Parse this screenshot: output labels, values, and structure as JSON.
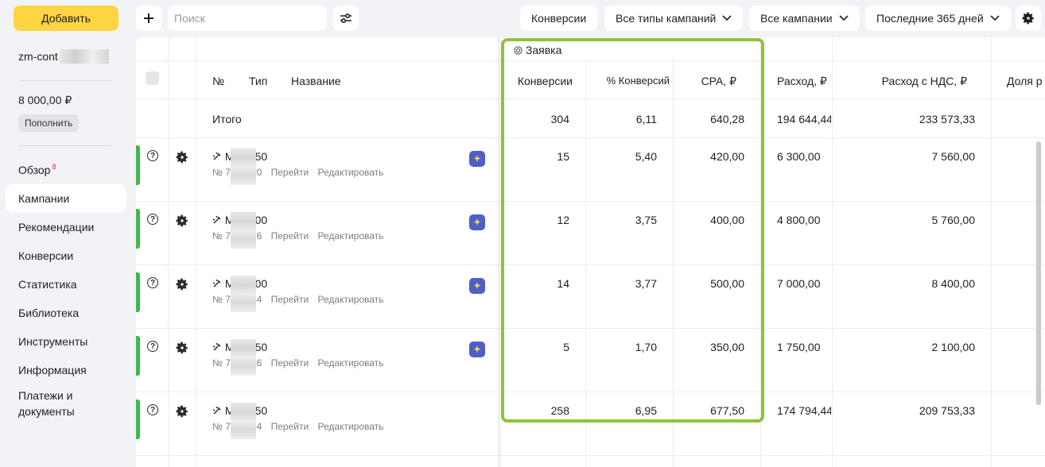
{
  "sidebar": {
    "add_button": "Добавить",
    "account": "zm-cont",
    "balance": "8 000,00 ₽",
    "topup_button": "Пополнить",
    "nav": [
      {
        "label": "Обзор",
        "badge": "8"
      },
      {
        "label": "Кампании"
      },
      {
        "label": "Рекомендации"
      },
      {
        "label": "Конверсии"
      },
      {
        "label": "Статистика"
      },
      {
        "label": "Библиотека"
      },
      {
        "label": "Инструменты"
      },
      {
        "label": "Информация"
      },
      {
        "label": "Платежи и документы"
      }
    ]
  },
  "toolbar": {
    "search_placeholder": "Поиск",
    "conversions_button": "Конверсии",
    "campaign_types": "Все типы кампаний",
    "campaigns": "Все кампании",
    "period": "Последние 365 дней"
  },
  "table": {
    "group_header": "Заявка",
    "headers": {
      "num": "№",
      "type": "Тип",
      "name": "Название",
      "conversions": "Конверсии",
      "conv_pct": "% Конверсий",
      "cpa": "CPA, ₽",
      "spend": "Расход, ₽",
      "spend_vat": "Расход с НДС, ₽",
      "share": "Доля р"
    },
    "total": {
      "label": "Итого",
      "conversions": "304",
      "conv_pct": "6,11",
      "cpa": "640,28",
      "spend": "194 644,44",
      "spend_vat": "233 573,33"
    },
    "link_go": "Перейти",
    "link_edit": "Редактировать",
    "rows": [
      {
        "name_a": "М",
        "name_b": "50",
        "id_a": "№ 7",
        "id_b": "90",
        "conversions": "15",
        "conv_pct": "5,40",
        "cpa": "420,00",
        "spend": "6 300,00",
        "spend_vat": "7 560,00"
      },
      {
        "name_a": "М",
        "name_b": "00",
        "id_a": "№ 7",
        "id_b": "26",
        "conversions": "12",
        "conv_pct": "3,75",
        "cpa": "400,00",
        "spend": "4 800,00",
        "spend_vat": "5 760,00"
      },
      {
        "name_a": "М",
        "name_b": "00",
        "id_a": "№ 7",
        "id_b": "44",
        "conversions": "14",
        "conv_pct": "3,77",
        "cpa": "500,00",
        "spend": "7 000,00",
        "spend_vat": "8 400,00"
      },
      {
        "name_a": "М",
        "name_b": "50",
        "id_a": "№ 7",
        "id_b": "66",
        "conversions": "5",
        "conv_pct": "1,70",
        "cpa": "350,00",
        "spend": "1 750,00",
        "spend_vat": "2 100,00"
      },
      {
        "name_a": "М",
        "name_b": "50",
        "id_a": "№ 7",
        "id_b": "94",
        "conversions": "258",
        "conv_pct": "6,95",
        "cpa": "677,50",
        "spend": "174 794,44",
        "spend_vat": "209 753,33"
      }
    ]
  },
  "colors": {
    "accent": "#fed542",
    "highlight": "#8fc33a",
    "status": "#3fb947",
    "ai_badge": "#4f5ec9"
  }
}
